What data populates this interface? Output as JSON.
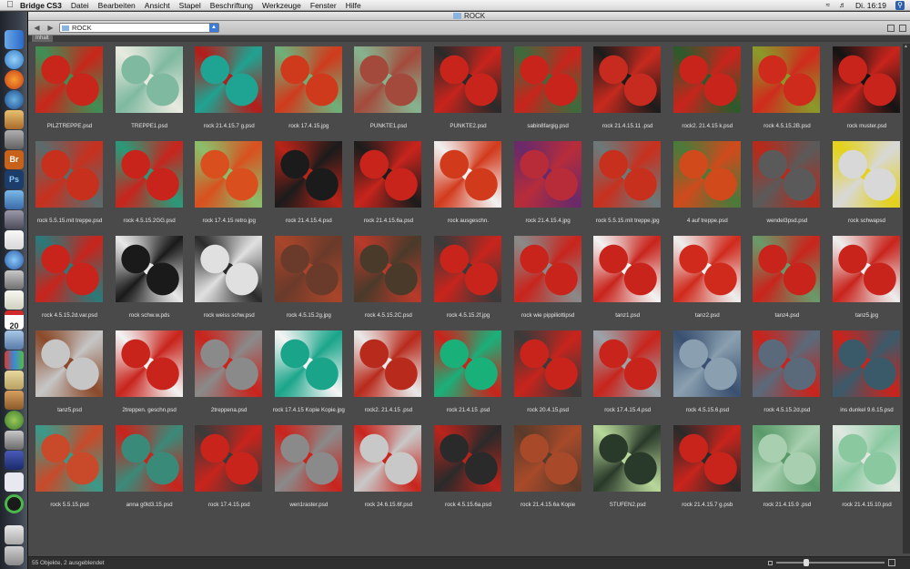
{
  "menubar": {
    "app": "Bridge CS3",
    "items": [
      "Datei",
      "Bearbeiten",
      "Ansicht",
      "Stapel",
      "Beschriftung",
      "Werkzeuge",
      "Fenster",
      "Hilfe"
    ],
    "clock": "Di. 16:19"
  },
  "window": {
    "title": "ROCK"
  },
  "toolbar": {
    "path": "ROCK"
  },
  "tab": {
    "label": "Inhalt"
  },
  "status": {
    "text": "55 Objekte, 2 ausgeblendet"
  },
  "files": [
    {
      "name": "PILZTREPPE.psd",
      "c1": "#c8261a",
      "c2": "#3f8f55"
    },
    {
      "name": "TREPPE1.psd",
      "c1": "#7fb9a0",
      "c2": "#e9eadf"
    },
    {
      "name": "rock 21.4.15.7 g.psd",
      "c1": "#1fa392",
      "c2": "#b31d1a"
    },
    {
      "name": "rock 17.4.15.jpg",
      "c1": "#d03a1c",
      "c2": "#6fb07a"
    },
    {
      "name": "PUNKTE1.psd",
      "c1": "#a44a3c",
      "c2": "#86b48f"
    },
    {
      "name": "PUNKTE2.psd",
      "c1": "#c8241c",
      "c2": "#2a2a2a"
    },
    {
      "name": "sabin8fargig.psd",
      "c1": "#c8241c",
      "c2": "#3d6b3d"
    },
    {
      "name": "rock 21.4.15.11 .psd",
      "c1": "#c72a1e",
      "c2": "#1c1c1c"
    },
    {
      "name": "rock2. 21.4.15 k.psd",
      "c1": "#c8241c",
      "c2": "#2c5a2c"
    },
    {
      "name": "rock 4.5.15.2B.psd",
      "c1": "#cf2b1c",
      "c2": "#8a9a2a"
    },
    {
      "name": "rock muster.psd",
      "c1": "#c8241c",
      "c2": "#141414"
    },
    {
      "name": "rock 5.5.15.mit treppe.psd",
      "c1": "#c8301e",
      "c2": "#5b6b6b"
    },
    {
      "name": "rock 4.5.15.2GG.psd",
      "c1": "#c8241c",
      "c2": "#2a9a7a"
    },
    {
      "name": "rock 17.4.15 retro.jpg",
      "c1": "#d9501e",
      "c2": "#8bbf6b"
    },
    {
      "name": "rock 21.4.15.4.psd",
      "c1": "#1b1b1b",
      "c2": "#b82418"
    },
    {
      "name": "rock 21.4.15.6a.psd",
      "c1": "#c8241c",
      "c2": "#1c1c1c"
    },
    {
      "name": "rock ausgeschn.",
      "c1": "#d23a1c",
      "c2": "#f0f0f0"
    },
    {
      "name": "rock 21.4.15.4.jpg",
      "c1": "#b82c3a",
      "c2": "#6a2a6a"
    },
    {
      "name": "rock 5.5.15.mit treppe.jpg",
      "c1": "#c8301e",
      "c2": "#6a7a7a"
    },
    {
      "name": "4 auf treppe.psd",
      "c1": "#d04a1c",
      "c2": "#4a7a3a"
    },
    {
      "name": "wendel3psd.psd",
      "c1": "#5a5a5a",
      "c2": "#b82a1a"
    },
    {
      "name": "rock  schwapsd",
      "c1": "#d8d8d8",
      "c2": "#e4d21a"
    },
    {
      "name": "rock 4.5.15.2d.var.psd",
      "c1": "#c8241c",
      "c2": "#2a7a7a"
    },
    {
      "name": "rock schw.w.pds",
      "c1": "#1a1a1a",
      "c2": "#e8e8e8"
    },
    {
      "name": "rock weiss schw.psd",
      "c1": "#e0e0e0",
      "c2": "#2a2a2a"
    },
    {
      "name": "rock 4.5.15.2g.jpg",
      "c1": "#6a3a2a",
      "c2": "#a8452a"
    },
    {
      "name": "rock 4.5.15.2C.psd",
      "c1": "#4a3a2a",
      "c2": "#b83a2a"
    },
    {
      "name": "rock 4.5.15.2f.jpg",
      "c1": "#c8241c",
      "c2": "#3a3a3a"
    },
    {
      "name": "rock wie pippiliottipsd",
      "c1": "#c8241c",
      "c2": "#8a8a8a"
    },
    {
      "name": "tanz1.psd",
      "c1": "#c8241c",
      "c2": "#f2f2f2"
    },
    {
      "name": "tanz2.psd",
      "c1": "#d02a1c",
      "c2": "#eeeeee"
    },
    {
      "name": "tanz4.psd",
      "c1": "#c8241c",
      "c2": "#6a9a6a"
    },
    {
      "name": "tanz5.jpg",
      "c1": "#c8241c",
      "c2": "#ededed"
    },
    {
      "name": "tanz5.psd",
      "c1": "#c6c6c6",
      "c2": "#8a4a2a"
    },
    {
      "name": "2treppen. geschn.psd",
      "c1": "#c8241c",
      "c2": "#f2f2f2"
    },
    {
      "name": "2treppena.psd",
      "c1": "#8a8a8a",
      "c2": "#c8241c"
    },
    {
      "name": "rock 17.4.15 Kopie Kopie.jpg",
      "c1": "#1aa58a",
      "c2": "#f4f4f4"
    },
    {
      "name": "rock2. 21.4.15 .psd",
      "c1": "#b82a1c",
      "c2": "#e8e8e8"
    },
    {
      "name": "rock 21.4.15 .psd",
      "c1": "#1ab07a",
      "c2": "#c8241c"
    },
    {
      "name": "rock 20.4.15.psd",
      "c1": "#c8241c",
      "c2": "#3a3a3a"
    },
    {
      "name": "rock 17.4.15.4.psd",
      "c1": "#c8241c",
      "c2": "#9aa4aa"
    },
    {
      "name": "rock 4.5.15.6.psd",
      "c1": "#8aa0b0",
      "c2": "#3a5070"
    },
    {
      "name": "rock 4.5.15.2d.psd",
      "c1": "#5a6a7a",
      "c2": "#c8241c"
    },
    {
      "name": "ins dunkel 9.6.15.psd",
      "c1": "#3a5a6a",
      "c2": "#c8241c"
    },
    {
      "name": "rock 5.5.15.psd",
      "c1": "#c84a2a",
      "c2": "#3a9a8a"
    },
    {
      "name": "anna g0ld3.15.psd",
      "c1": "#3a8a7a",
      "c2": "#c8241c"
    },
    {
      "name": "rock 17.4.15.psd",
      "c1": "#c8241c",
      "c2": "#3a3a3a"
    },
    {
      "name": "wen1raster.psd",
      "c1": "#8a8a8a",
      "c2": "#c8241c"
    },
    {
      "name": "rock 24.6.15.6f.psd",
      "c1": "#c8c8c8",
      "c2": "#c8241c"
    },
    {
      "name": "rock 4.5.15.6a.psd",
      "c1": "#2a2a2a",
      "c2": "#b8241c"
    },
    {
      "name": "rock 21.4.15.6a Kopie",
      "c1": "#a84a2a",
      "c2": "#5a3a2a"
    },
    {
      "name": "STUFEN2.psd",
      "c1": "#2a3a2a",
      "c2": "#b8d89a"
    },
    {
      "name": "rock 21.4.15.7 g.psb",
      "c1": "#c8241c",
      "c2": "#2a2a2a"
    },
    {
      "name": "rock 21.4.15.9 .psd",
      "c1": "#a8d0b0",
      "c2": "#5a9a6a"
    },
    {
      "name": "rock 21.4.15.10.psd",
      "c1": "#8ac8a0",
      "c2": "#dfe8e0"
    }
  ]
}
